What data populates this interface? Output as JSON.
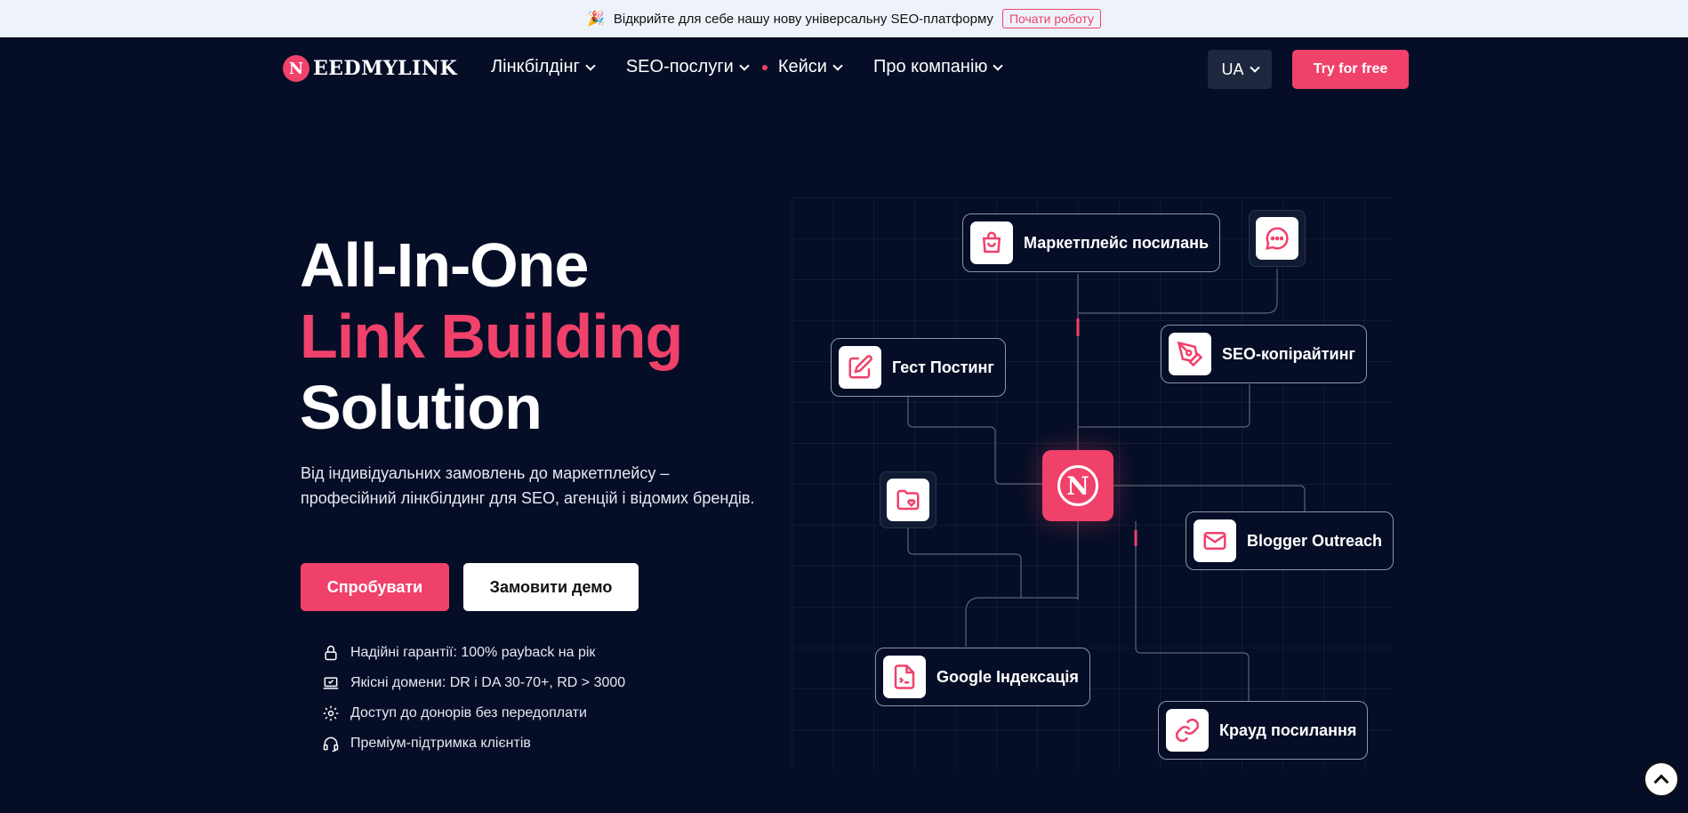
{
  "banner": {
    "emoji": "🎉",
    "text": "Відкрийте для себе нашу нову універсальну SEO-платформу",
    "cta": "Почати роботу"
  },
  "header": {
    "logo_letter": "N",
    "logo_text": "EEDMYLINK",
    "nav": [
      {
        "label": "Лінкбілдінг"
      },
      {
        "label": "SEO-послуги"
      },
      {
        "label": "Кейси"
      },
      {
        "label": "Про компанію"
      }
    ],
    "lang": "UA",
    "try_label": "Try for free"
  },
  "hero": {
    "title_line1": "All-In-One",
    "title_line2": "Link Building",
    "title_line3": "Solution",
    "subtitle": "Від індивідуальних замовлень до маркетплейсу – професійний лінкбілдинг для SEO, агенцій і відомих брендів.",
    "primary_button": "Спробувати",
    "secondary_button": "Замовити демо",
    "features": [
      "Надійні гарантії: 100% payback на рік",
      "Якісні домени: DR і DA 30-70+, RD > 3000",
      "Доступ до донорів без передоплати",
      "Преміум-підтримка клієнтів"
    ]
  },
  "diagram": {
    "center_letter": "N",
    "nodes": {
      "marketplace": "Маркетплейс посилань",
      "copywriting": "SEO-копірайтинг",
      "guest": "Гест Постинг",
      "outreach": "Blogger Outreach",
      "indexing": "Google Індексація",
      "crowd": "Крауд посилання"
    }
  },
  "colors": {
    "accent": "#f0416b",
    "background": "#050e26",
    "banner_bg": "#eef3fb"
  }
}
